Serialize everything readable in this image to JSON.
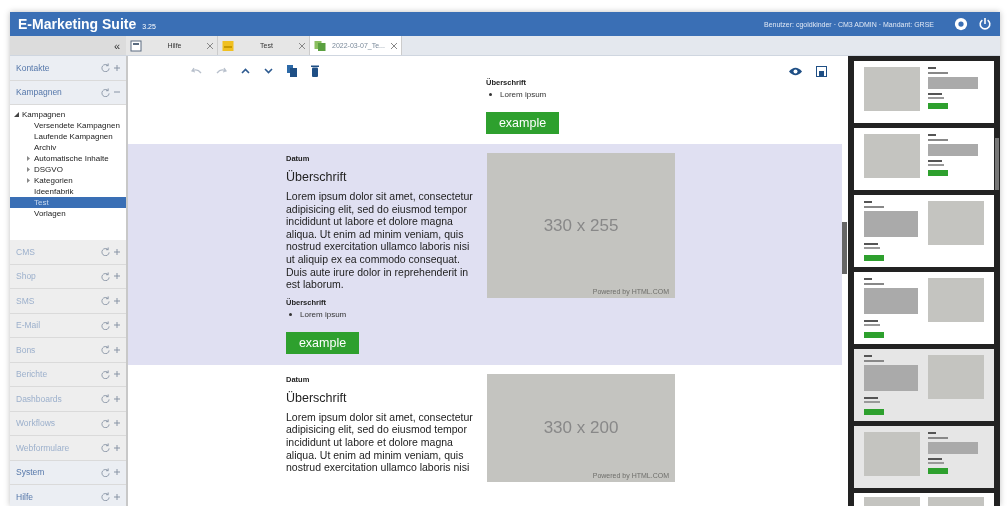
{
  "app": {
    "title": "E-Marketing Suite",
    "version": "3.25",
    "user_info": "Benutzer: cgoldkinder · CM3 ADMIN · Mandant: GRSE"
  },
  "tabs": [
    {
      "label": "Hilfe",
      "selected": false
    },
    {
      "label": "Test",
      "selected": false
    },
    {
      "label": "2022-03-07_Te...",
      "selected": true
    }
  ],
  "sidebar": {
    "collapse": "«",
    "sections": [
      {
        "label": "Kontakte",
        "expanded": false,
        "disabled": false
      },
      {
        "label": "Kampagnen",
        "expanded": true,
        "disabled": false,
        "tree": [
          {
            "label": "Kampagnen",
            "expanded": true,
            "selected": false,
            "children": [
              {
                "label": "Versendete Kampagnen",
                "selected": false
              },
              {
                "label": "Laufende Kampagnen",
                "selected": false
              },
              {
                "label": "Archiv",
                "selected": false
              },
              {
                "label": "Automatische Inhalte",
                "expanded": false,
                "selected": false
              },
              {
                "label": "DSGVO",
                "expanded": false,
                "selected": false
              },
              {
                "label": "Kategorien",
                "expanded": false,
                "selected": false
              },
              {
                "label": "Ideenfabrik",
                "selected": false
              },
              {
                "label": "Test",
                "selected": true
              },
              {
                "label": "Vorlagen",
                "selected": false
              }
            ]
          }
        ]
      },
      {
        "label": "CMS",
        "expanded": false,
        "disabled": true
      },
      {
        "label": "Shop",
        "expanded": false,
        "disabled": true
      },
      {
        "label": "SMS",
        "expanded": false,
        "disabled": true
      },
      {
        "label": "E-Mail",
        "expanded": false,
        "disabled": true
      },
      {
        "label": "Bons",
        "expanded": false,
        "disabled": true
      },
      {
        "label": "Berichte",
        "expanded": false,
        "disabled": true
      },
      {
        "label": "Dashboards",
        "expanded": false,
        "disabled": true
      },
      {
        "label": "Workflows",
        "expanded": false,
        "disabled": true
      },
      {
        "label": "Webformulare",
        "expanded": false,
        "disabled": true
      },
      {
        "label": "System",
        "expanded": false,
        "disabled": false
      },
      {
        "label": "Hilfe",
        "expanded": false,
        "disabled": false
      }
    ]
  },
  "toolbar": {
    "undo_disabled": true,
    "redo_disabled": true
  },
  "blocks": [
    {
      "selected": false,
      "kind": "text-right",
      "subheading": "Überschrift",
      "bullets": [
        "Lorem ipsum"
      ],
      "button": "example"
    },
    {
      "selected": true,
      "kind": "image-right",
      "date": "Datum",
      "heading": "Überschrift",
      "text": "Lorem ipsum dolor sit amet, consectetur adipisicing elit, sed do eiusmod tempor incididunt ut labore et dolore magna aliqua. Ut enim ad minim veniam, quis nostrud exercitation ullamco laboris nisi ut aliquip ex ea commodo consequat. Duis aute irure dolor in reprehenderit in est laborum.",
      "subheading": "Überschrift",
      "bullets": [
        "Lorem ipsum"
      ],
      "button": "example",
      "image_label": "330 x 255",
      "image_credit": "Powered by HTML.COM"
    },
    {
      "selected": false,
      "kind": "image-right",
      "date": "Datum",
      "heading": "Überschrift",
      "text": "Lorem ipsum dolor sit amet, consectetur adipisicing elit, sed do eiusmod tempor incididunt ut labore et dolore magna aliqua. Ut enim ad minim veniam, quis nostrud exercitation ullamco laboris nisi",
      "image_label": "330 x 200",
      "image_credit": "Powered by HTML.COM"
    }
  ],
  "thumbnails": [
    {
      "kind": "image-left",
      "highlighted": false
    },
    {
      "kind": "image-left",
      "highlighted": false
    },
    {
      "kind": "image-right",
      "highlighted": false
    },
    {
      "kind": "image-right",
      "highlighted": false
    },
    {
      "kind": "image-right",
      "highlighted": true
    },
    {
      "kind": "image-left",
      "highlighted": true
    },
    {
      "kind": "two-images",
      "highlighted": false
    }
  ]
}
